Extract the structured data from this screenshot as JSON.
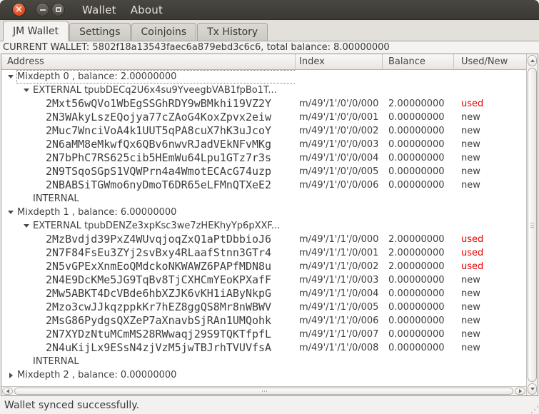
{
  "titlebar": {
    "menu": [
      "Wallet",
      "About"
    ],
    "icons": {
      "close": "×",
      "minimize": "minimize-bar",
      "maximize": "maximize-box"
    }
  },
  "tabs": [
    {
      "label": "JM Wallet",
      "active": true
    },
    {
      "label": "Settings",
      "active": false
    },
    {
      "label": "Coinjoins",
      "active": false
    },
    {
      "label": "Tx History",
      "active": false
    }
  ],
  "banner": {
    "text": "CURRENT WALLET: 5802f18a13543faec6a879ebd3c6c6, total balance: 8.00000000"
  },
  "table": {
    "columns": [
      "Address",
      "Index",
      "Balance",
      "Used/New"
    ],
    "rows": [
      {
        "level": 0,
        "expander": "open",
        "focused": true,
        "mono": false,
        "label": "Mixdepth 0 , balance: 2.00000000",
        "index": "",
        "balance": "",
        "status": ""
      },
      {
        "level": 1,
        "expander": "open",
        "focused": false,
        "mono": false,
        "label": "EXTERNAL tpubDECq2U6x4su9YveegbVAB1fpBo1T...",
        "index": "",
        "balance": "",
        "status": ""
      },
      {
        "level": 2,
        "expander": "none",
        "focused": false,
        "mono": true,
        "label": "2Mxt56wQVo1WbEgSSGhRDY9wBMkhi19VZ2Y",
        "index": "m/49'/1'/0'/0/000",
        "balance": "2.00000000",
        "status": "used"
      },
      {
        "level": 2,
        "expander": "none",
        "focused": false,
        "mono": true,
        "label": "2N3WAkyLszEQojya77cZAoG4KoxZpvx2eiw",
        "index": "m/49'/1'/0'/0/001",
        "balance": "0.00000000",
        "status": "new"
      },
      {
        "level": 2,
        "expander": "none",
        "focused": false,
        "mono": true,
        "label": "2Muc7WnciVoA4k1UUT5qPA8cuX7hK3uJcoY",
        "index": "m/49'/1'/0'/0/002",
        "balance": "0.00000000",
        "status": "new"
      },
      {
        "level": 2,
        "expander": "none",
        "focused": false,
        "mono": true,
        "label": "2N6aMM8eMkwfQx6QBv6nwvRJadVEkNFvMKg",
        "index": "m/49'/1'/0'/0/003",
        "balance": "0.00000000",
        "status": "new"
      },
      {
        "level": 2,
        "expander": "none",
        "focused": false,
        "mono": true,
        "label": "2N7bPhC7RS625cib5HEmWu64Lpu1GTz7r3s",
        "index": "m/49'/1'/0'/0/004",
        "balance": "0.00000000",
        "status": "new"
      },
      {
        "level": 2,
        "expander": "none",
        "focused": false,
        "mono": true,
        "label": "2N9TSqoSGpS1VQWPrn4a4WmotECAcG74uzp",
        "index": "m/49'/1'/0'/0/005",
        "balance": "0.00000000",
        "status": "new"
      },
      {
        "level": 2,
        "expander": "none",
        "focused": false,
        "mono": true,
        "label": "2NBABSiTGWmo6nyDmoT6DR65eLFMnQTXeE2",
        "index": "m/49'/1'/0'/0/006",
        "balance": "0.00000000",
        "status": "new"
      },
      {
        "level": 1,
        "expander": "none",
        "focused": false,
        "mono": false,
        "label": "INTERNAL",
        "index": "",
        "balance": "",
        "status": ""
      },
      {
        "level": 0,
        "expander": "open",
        "focused": false,
        "mono": false,
        "label": "Mixdepth 1 , balance: 6.00000000",
        "index": "",
        "balance": "",
        "status": ""
      },
      {
        "level": 1,
        "expander": "open",
        "focused": false,
        "mono": false,
        "label": "EXTERNAL tpubDENZe3xpKsc3we7zHEKhyYp6pXXF...",
        "index": "",
        "balance": "",
        "status": ""
      },
      {
        "level": 2,
        "expander": "none",
        "focused": false,
        "mono": true,
        "label": "2MzBvdjd39PxZ4WUvqjoqZxQ1aPtDbbioJ6",
        "index": "m/49'/1'/1'/0/000",
        "balance": "2.00000000",
        "status": "used"
      },
      {
        "level": 2,
        "expander": "none",
        "focused": false,
        "mono": true,
        "label": "2N7F84FsEu3ZYj2svBxy4RLaafStnn3GTr4",
        "index": "m/49'/1'/1'/0/001",
        "balance": "2.00000000",
        "status": "used"
      },
      {
        "level": 2,
        "expander": "none",
        "focused": false,
        "mono": true,
        "label": "2N5vGPExXnmEoQMdckoNKWAWZ6PAPfMDN8u",
        "index": "m/49'/1'/1'/0/002",
        "balance": "2.00000000",
        "status": "used"
      },
      {
        "level": 2,
        "expander": "none",
        "focused": false,
        "mono": true,
        "label": "2N4E9DcKMe5JG9TqBv8TjCXHCmYEoKPXafF",
        "index": "m/49'/1'/1'/0/003",
        "balance": "0.00000000",
        "status": "new"
      },
      {
        "level": 2,
        "expander": "none",
        "focused": false,
        "mono": true,
        "label": "2Mw5ABKT4DcVBde6hbXZJK6vKH1iAByNkpG",
        "index": "m/49'/1'/1'/0/004",
        "balance": "0.00000000",
        "status": "new"
      },
      {
        "level": 2,
        "expander": "none",
        "focused": false,
        "mono": true,
        "label": "2Mzo3cwJJkqzppkKr7hEZ8ggQS8Mr8nWBWV",
        "index": "m/49'/1'/1'/0/005",
        "balance": "0.00000000",
        "status": "new"
      },
      {
        "level": 2,
        "expander": "none",
        "focused": false,
        "mono": true,
        "label": "2MsG86PydgsQXZeP7aXnavbSjRAn1UMQohk",
        "index": "m/49'/1'/1'/0/006",
        "balance": "0.00000000",
        "status": "new"
      },
      {
        "level": 2,
        "expander": "none",
        "focused": false,
        "mono": true,
        "label": "2N7XYDzNtuMCmMS28RWwaqj29S9TQKTfpfL",
        "index": "m/49'/1'/1'/0/007",
        "balance": "0.00000000",
        "status": "new"
      },
      {
        "level": 2,
        "expander": "none",
        "focused": false,
        "mono": true,
        "label": "2N4uKijLx9ESsN4zjVzM5jwTBJrhTVUVfsA",
        "index": "m/49'/1'/1'/0/008",
        "balance": "0.00000000",
        "status": "new"
      },
      {
        "level": 1,
        "expander": "none",
        "focused": false,
        "mono": false,
        "label": "INTERNAL",
        "index": "",
        "balance": "",
        "status": ""
      },
      {
        "level": 0,
        "expander": "closed",
        "focused": false,
        "mono": false,
        "label": "Mixdepth 2 , balance: 0.00000000",
        "index": "",
        "balance": "",
        "status": ""
      }
    ]
  },
  "statusbar": {
    "message": "Wallet synced successfully."
  },
  "colors": {
    "used_status": "#e60000",
    "close_button": "#e25427",
    "titlebar_bg": "#3b3934"
  }
}
